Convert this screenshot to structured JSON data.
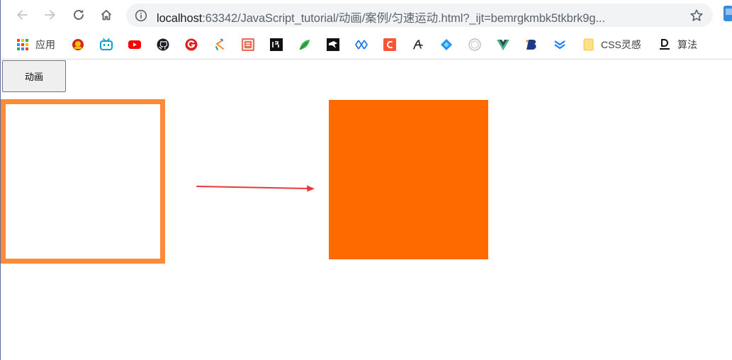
{
  "toolbar": {
    "back_icon": "back-arrow-icon",
    "forward_icon": "forward-arrow-icon",
    "reload_icon": "reload-icon",
    "home_icon": "home-icon",
    "url_host": "localhost",
    "url_rest": ":63342/JavaScript_tutorial/动画/案例/匀速运动.html?_ijt=bemrgkmbk5tkbrk9g...",
    "bookmark_star_icon": "star-icon"
  },
  "bookmarks": {
    "items": [
      {
        "label": "应用",
        "icon": "apps-grid-icon"
      },
      {
        "label": "",
        "icon": "emblem-icon"
      },
      {
        "label": "",
        "icon": "bilibili-icon"
      },
      {
        "label": "",
        "icon": "youtube-icon"
      },
      {
        "label": "",
        "icon": "github-icon"
      },
      {
        "label": "",
        "icon": "g-red-circle-icon"
      },
      {
        "label": "",
        "icon": "juejin-icon"
      },
      {
        "label": "",
        "icon": "jianshu-icon"
      },
      {
        "label": "",
        "icon": "square-black-icon"
      },
      {
        "label": "",
        "icon": "green-leaf-icon"
      },
      {
        "label": "",
        "icon": "black-bird-icon"
      },
      {
        "label": "",
        "icon": "blue-link-icon"
      },
      {
        "label": "",
        "icon": "csdn-c-icon"
      },
      {
        "label": "",
        "icon": "script-a-icon"
      },
      {
        "label": "",
        "icon": "blue-diamond-icon"
      },
      {
        "label": "",
        "icon": "grey-seal-icon"
      },
      {
        "label": "",
        "icon": "vue-icon"
      },
      {
        "label": "",
        "icon": "b-logo-icon"
      },
      {
        "label": "",
        "icon": "blue-chevrons-icon"
      },
      {
        "label": "CSS灵感",
        "icon": "folder-icon"
      },
      {
        "label": "算法",
        "icon": "d-logo-icon"
      }
    ]
  },
  "page": {
    "animate_button_label": "动画",
    "colors": {
      "start_border": "#ff8a3a",
      "end_fill": "#ff6a00",
      "arrow": "#e8383d"
    }
  }
}
